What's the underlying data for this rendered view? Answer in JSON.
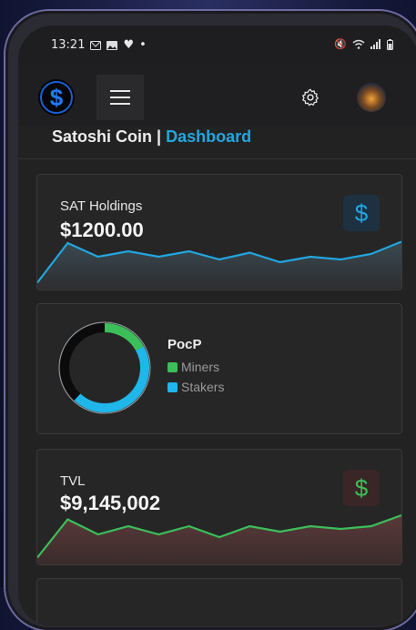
{
  "status": {
    "time": "13:21",
    "left_icons": [
      "mail-icon",
      "image-icon",
      "heart-icon"
    ],
    "right_icons": [
      "mute-icon",
      "wifi-icon",
      "signal-icon",
      "battery-icon"
    ]
  },
  "header": {
    "app_name": "Satoshi Coin",
    "separator": "|",
    "section": "Dashboard"
  },
  "colors": {
    "accent": "#22a6e0",
    "green": "#3cbf5a",
    "background": "#222222"
  },
  "holdings": {
    "label": "SAT Holdings",
    "value": "$1200.00",
    "icon": "$",
    "icon_name": "dollar-icon",
    "spark": [
      5,
      34,
      24,
      28,
      24,
      28,
      22,
      27,
      20,
      24,
      22,
      26,
      35
    ]
  },
  "pocp": {
    "title": "PocP",
    "items": [
      {
        "label": "Miners",
        "color": "#3cbf5a",
        "share": 0.17
      },
      {
        "label": "Stakers",
        "color": "#1fb7ea",
        "share": 0.45
      },
      {
        "label": "",
        "color": "#0b0b0b",
        "share": 0.38
      }
    ]
  },
  "tvl": {
    "label": "TVL",
    "value": "$9,145,002",
    "icon": "$",
    "icon_name": "dollar-icon",
    "spark": [
      5,
      33,
      22,
      28,
      22,
      28,
      20,
      28,
      24,
      28,
      26,
      28,
      36
    ]
  }
}
